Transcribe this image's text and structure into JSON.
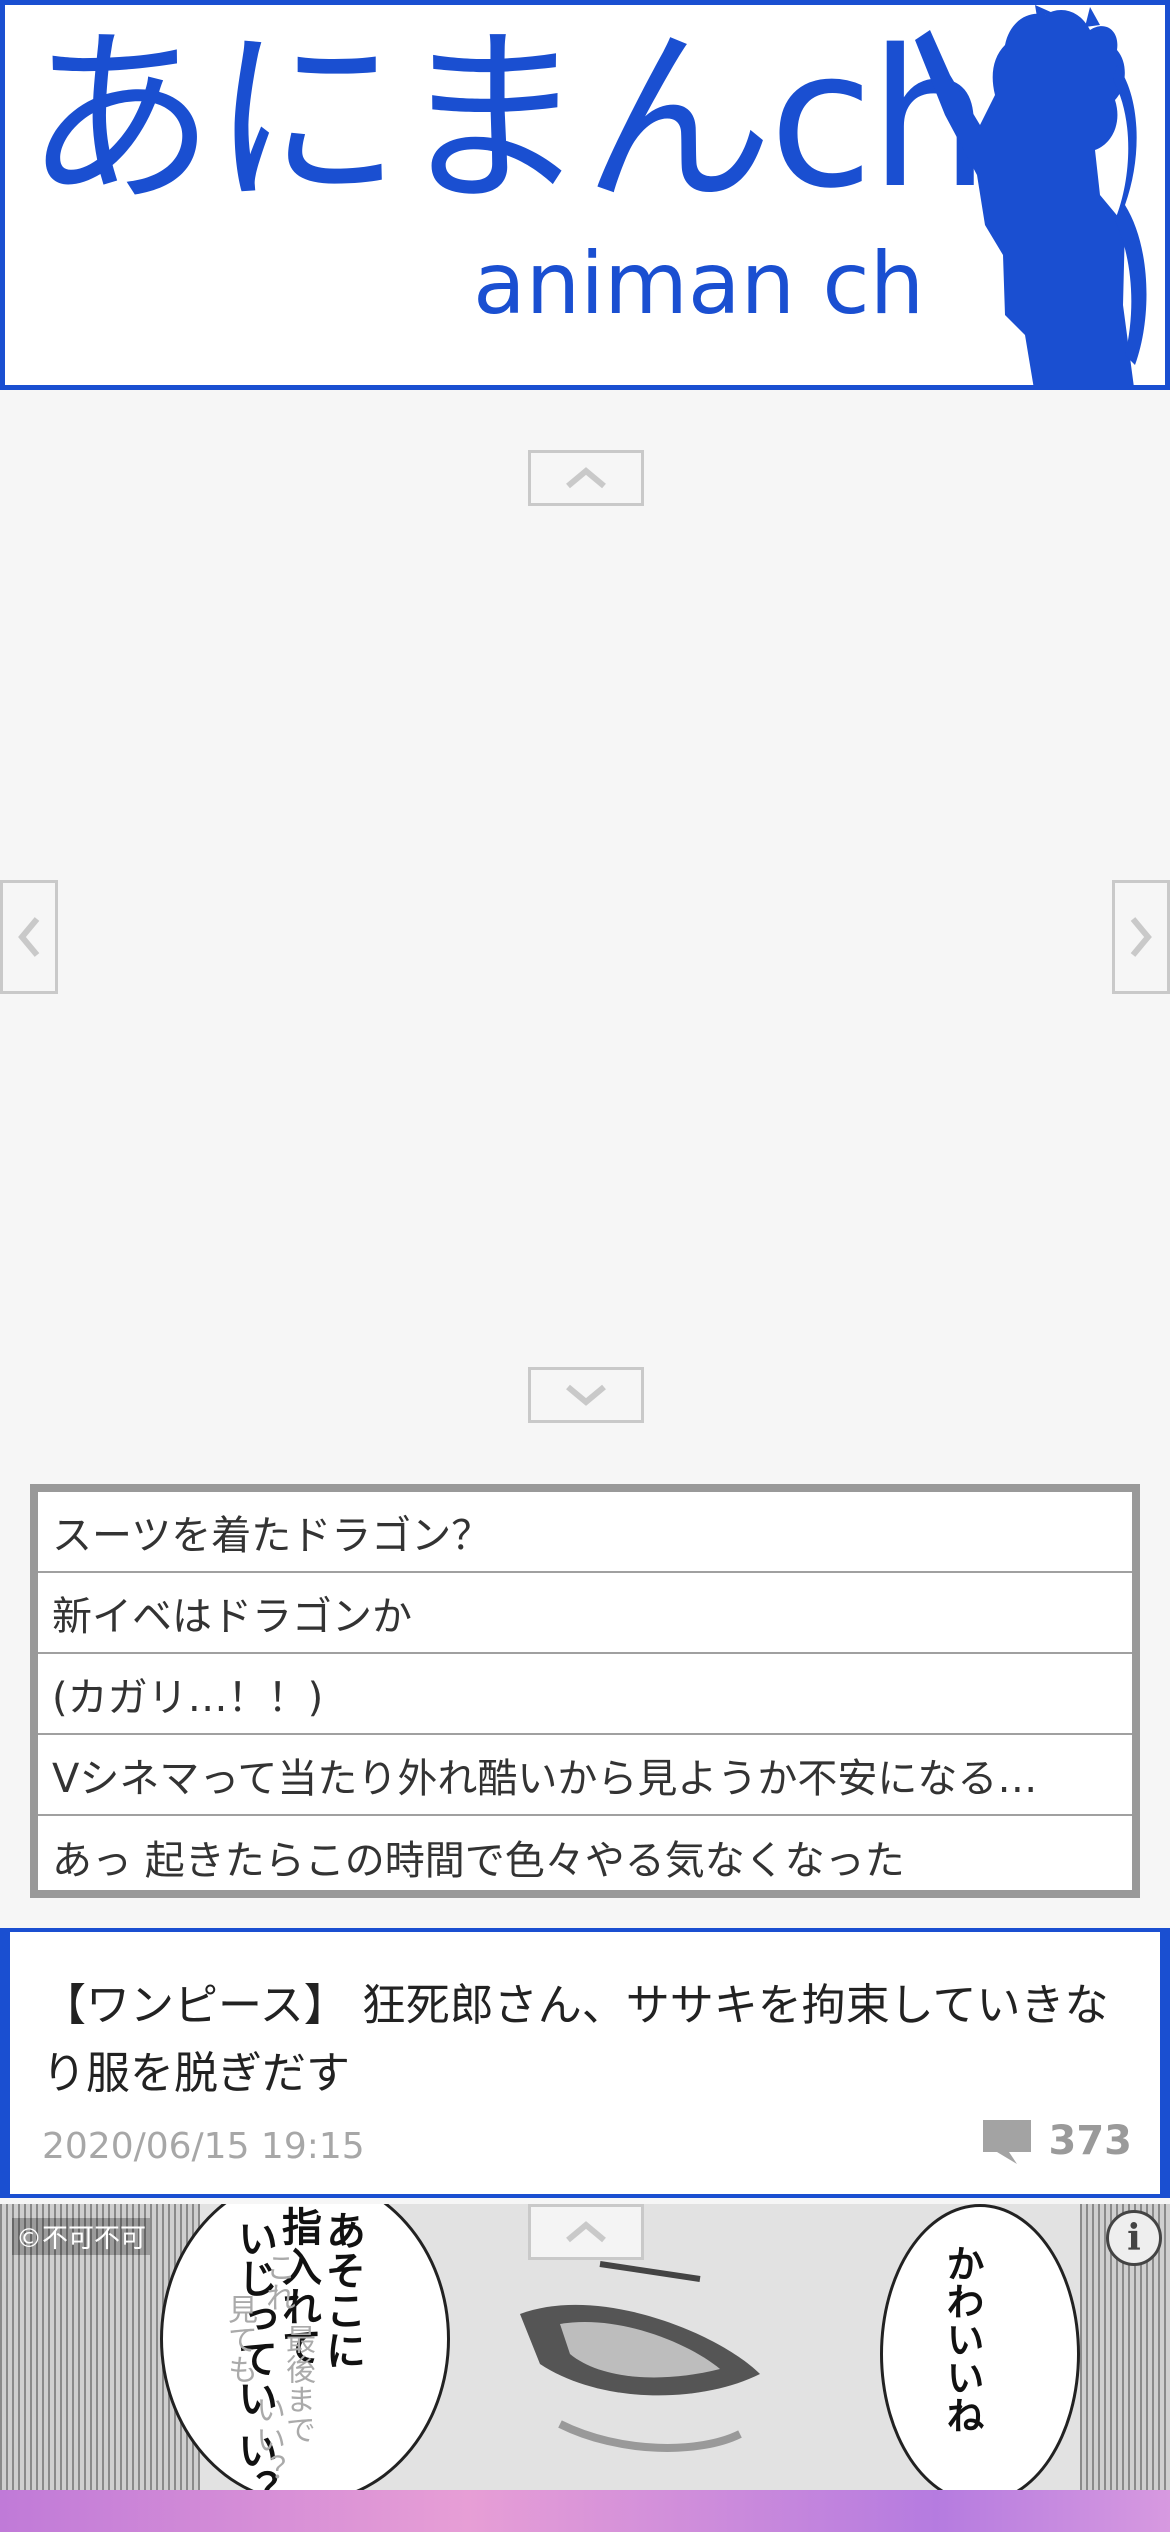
{
  "header": {
    "logo_main": "あにまんch",
    "logo_sub": "animan ch",
    "brand_color": "#1a4fd1"
  },
  "carousel": {
    "up_icon": "chevron-up-icon",
    "down_icon": "chevron-down-icon",
    "prev_icon": "chevron-left-icon",
    "next_icon": "chevron-right-icon"
  },
  "topics": [
    "スーツを着たドラゴン？",
    "新イベはドラゴンか",
    "(カガリ…！！)",
    "Vシネマって当たり外れ酷いから見ようか不安になる…",
    "あっ 起きたらこの時間で色々やる気なくなった"
  ],
  "article": {
    "title": "【ワンピース】 狂死郎さん、ササキを拘束していきなり服を脱ぎだす",
    "date": "2020/06/15 19:15",
    "comment_count": "373",
    "comment_icon": "speech-bubble-icon"
  },
  "ad": {
    "copyright": "©不可不可",
    "bubble_left_lines": [
      "あそこに",
      "指入れて",
      "いじってい",
      "い？"
    ],
    "bubble_left_faint": [
      "これ",
      "最後まで",
      "見ても",
      "いい？"
    ],
    "bubble_right_text": "かわいいね",
    "info_icon": "info-icon"
  }
}
